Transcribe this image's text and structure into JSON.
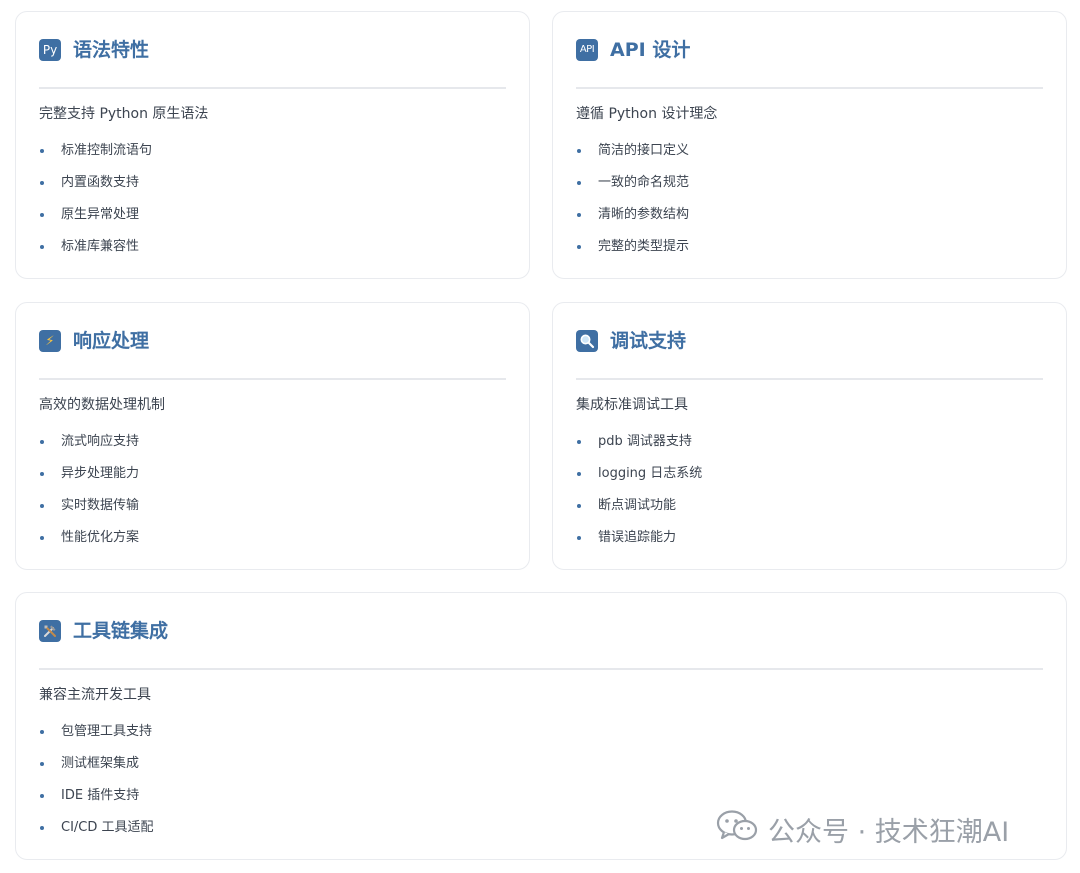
{
  "cards": [
    {
      "icon_name": "python-icon",
      "icon_text": "Py",
      "title": "语法特性",
      "subtitle": "完整支持 Python 原生语法",
      "items": [
        "标准控制流语句",
        "内置函数支持",
        "原生异常处理",
        "标准库兼容性"
      ]
    },
    {
      "icon_name": "api-icon",
      "icon_text": "API",
      "title": "API 设计",
      "subtitle": "遵循 Python 设计理念",
      "items": [
        "简洁的接口定义",
        "一致的命名规范",
        "清晰的参数结构",
        "完整的类型提示"
      ]
    },
    {
      "icon_name": "lightning-icon",
      "icon_text": "⚡",
      "title": "响应处理",
      "subtitle": "高效的数据处理机制",
      "items": [
        "流式响应支持",
        "异步处理能力",
        "实时数据传输",
        "性能优化方案"
      ]
    },
    {
      "icon_name": "magnifier-icon",
      "icon_text": "",
      "title": "调试支持",
      "subtitle": "集成标准调试工具",
      "items": [
        "pdb 调试器支持",
        "logging 日志系统",
        "断点调试功能",
        "错误追踪能力"
      ]
    },
    {
      "icon_name": "tools-icon",
      "icon_text": "",
      "title": "工具链集成",
      "subtitle": "兼容主流开发工具",
      "items": [
        "包管理工具支持",
        "测试框架集成",
        "IDE 插件支持",
        "CI/CD 工具适配"
      ]
    }
  ],
  "watermark": {
    "icon_name": "wechat-icon",
    "text": "公众号 · 技术狂潮AI"
  },
  "colors": {
    "accent": "#3f6fa3",
    "text": "#3c4450",
    "border": "#e9ebef",
    "watermark": "#9aa0a8"
  }
}
